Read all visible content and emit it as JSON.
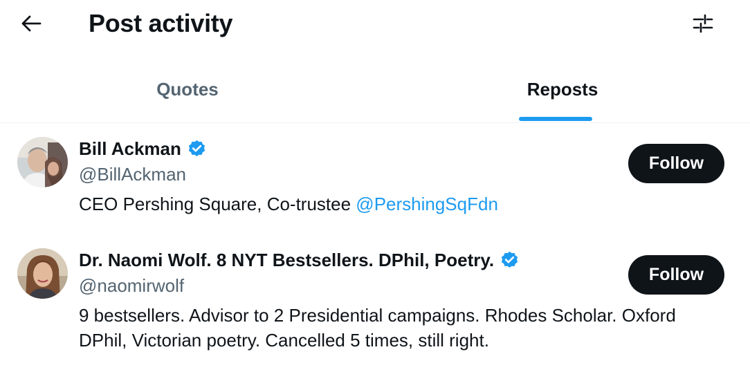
{
  "header": {
    "title": "Post activity",
    "back_icon": "arrow-left-icon",
    "filter_icon": "sliders-icon"
  },
  "tabs": [
    {
      "label": "Quotes",
      "active": false
    },
    {
      "label": "Reposts",
      "active": true
    }
  ],
  "colors": {
    "accent": "#1d9bf0",
    "text_primary": "#0f1419",
    "text_secondary": "#536471",
    "button_bg": "#0f1419"
  },
  "users": [
    {
      "name": "Bill Ackman",
      "handle": "@BillAckman",
      "verified": true,
      "bio_text": "CEO Pershing Square, Co-trustee ",
      "bio_mention": "@PershingSqFdn",
      "follow_label": "Follow"
    },
    {
      "name": "Dr. Naomi Wolf. 8 NYT Bestsellers. DPhil, Poetry.",
      "handle": "@naomirwolf",
      "verified": true,
      "bio_line1": "9 bestsellers. Advisor to 2 Presidential campaigns. Rhodes Scholar. Oxford",
      "bio_line2": "DPhil, Victorian poetry. Cancelled 5 times, still right.",
      "follow_label": "Follow"
    }
  ]
}
